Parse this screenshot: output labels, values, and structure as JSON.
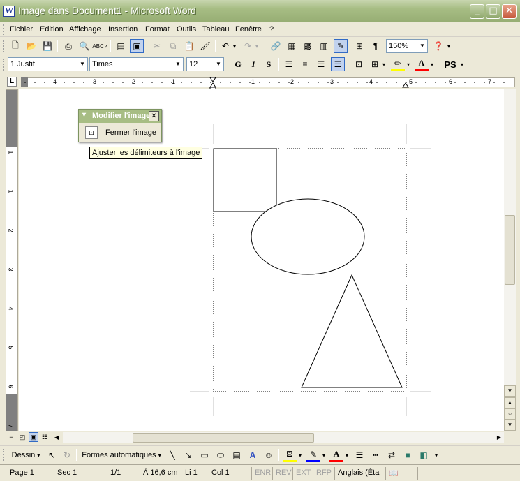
{
  "window": {
    "title": "Image dans Document1 - Microsoft Word"
  },
  "menu": [
    "Fichier",
    "Edition",
    "Affichage",
    "Insertion",
    "Format",
    "Outils",
    "Tableau",
    "Fenêtre",
    "?"
  ],
  "standard_toolbar": {
    "zoom": "150%"
  },
  "format_toolbar": {
    "style": "1 Justif",
    "font": "Times",
    "size": "12",
    "bold": "G",
    "italic": "I",
    "underline": "S",
    "ps": "PS"
  },
  "ruler": {
    "corner": "L",
    "h_labels": [
      "4",
      "3",
      "2",
      "1",
      "1",
      "2",
      "3",
      "4",
      "5",
      "6",
      "7"
    ],
    "v_labels": [
      "1",
      "1",
      "2",
      "3",
      "4",
      "5",
      "6",
      "7"
    ]
  },
  "picture_toolbar": {
    "title": "Modifier l'image",
    "close_label": "Fermer l'image",
    "tooltip": "Ajuster les délimiteurs à l'image"
  },
  "draw_toolbar": {
    "draw_label": "Dessin",
    "autoshapes_label": "Formes automatiques"
  },
  "status": {
    "page": "Page  1",
    "section": "Sec  1",
    "pages": "1/1",
    "position": "À  16,6 cm",
    "line": "Li  1",
    "column": "Col  1",
    "enr": "ENR",
    "rev": "REV",
    "ext": "EXT",
    "rfp": "RFP",
    "language": "Anglais (Éta"
  }
}
